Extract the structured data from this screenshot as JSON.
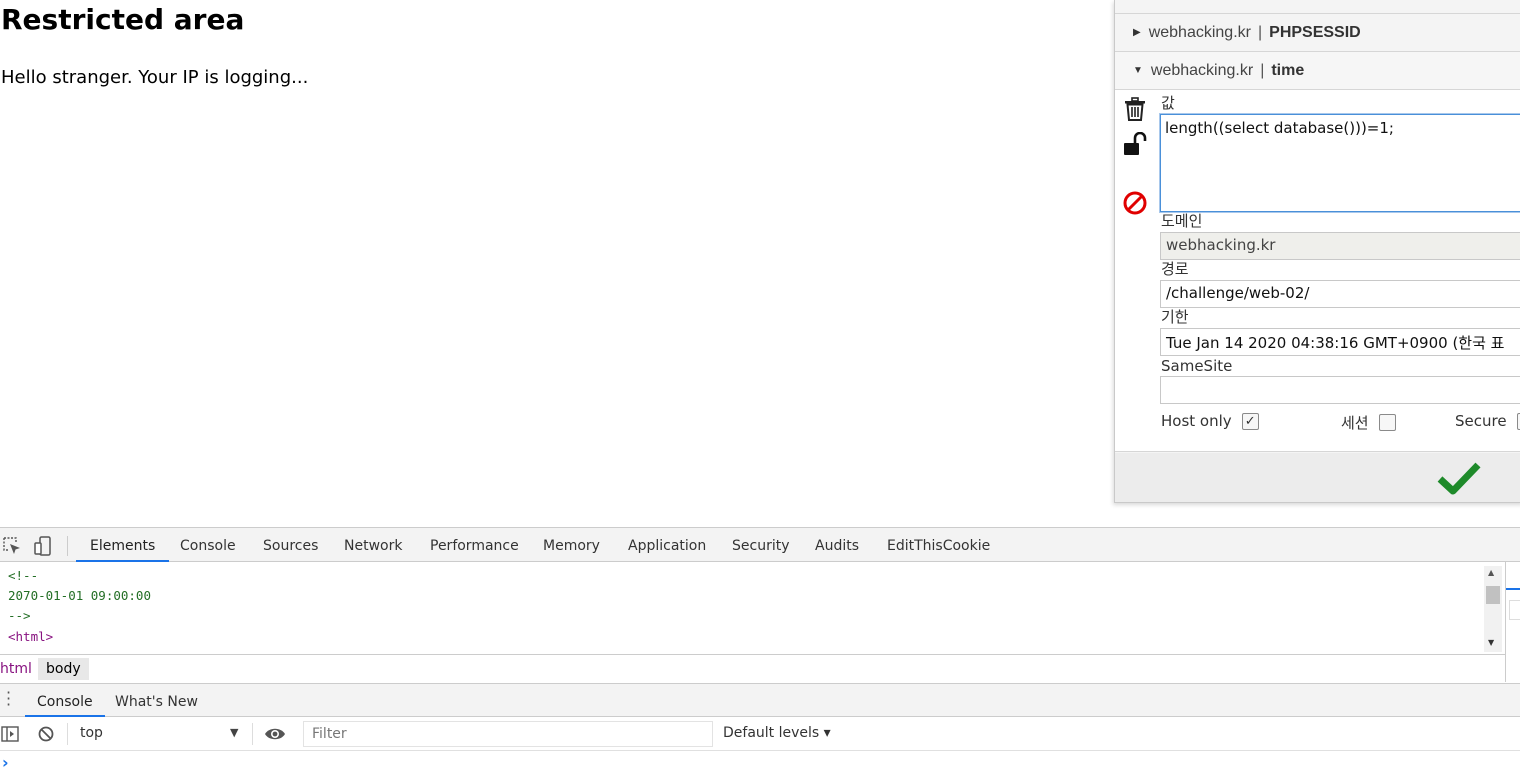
{
  "page": {
    "title": "Restricted area",
    "message": "Hello stranger. Your IP is logging..."
  },
  "cookie_editor": {
    "cookies": [
      {
        "domain": "webhacking.kr",
        "separator": "|",
        "name": "PHPSESSID",
        "expanded": false
      },
      {
        "domain": "webhacking.kr",
        "separator": "|",
        "name": "time",
        "expanded": true
      }
    ],
    "fields": {
      "value_label": "값",
      "value": "length((select database()))=1;",
      "domain_label": "도메인",
      "domain": "webhacking.kr",
      "path_label": "경로",
      "path": "/challenge/web-02/",
      "expiry_label": "기한",
      "expiry": "Tue Jan 14 2020 04:38:16 GMT+0900 (한국 표",
      "samesite_label": "SameSite",
      "samesite": ""
    },
    "flags": {
      "host_only_label": "Host only",
      "host_only": true,
      "session_label": "세션",
      "session": false,
      "secure_label": "Secure"
    },
    "icons": [
      "trash-icon",
      "unlock-icon",
      "block-icon",
      "checkmark-icon"
    ],
    "colors": {
      "accent_green": "#1e8a2a",
      "block_red": "#e00000"
    }
  },
  "devtools": {
    "tabs": [
      "Elements",
      "Console",
      "Sources",
      "Network",
      "Performance",
      "Memory",
      "Application",
      "Security",
      "Audits",
      "EditThisCookie"
    ],
    "active_tab": "Elements",
    "code_lines": [
      "<!--",
      "2070-01-01 09:00:00",
      "-->",
      "<html>"
    ],
    "breadcrumb": [
      "html",
      "body"
    ],
    "drawer_tabs": [
      "Console",
      "What's New"
    ],
    "drawer_active": "Console",
    "console": {
      "context": "top",
      "filter_placeholder": "Filter",
      "levels": "Default levels ▾",
      "prompt": "›"
    },
    "colors": {
      "accent": "#1a73e8",
      "comment": "#236e25",
      "tag": "#881280"
    }
  }
}
